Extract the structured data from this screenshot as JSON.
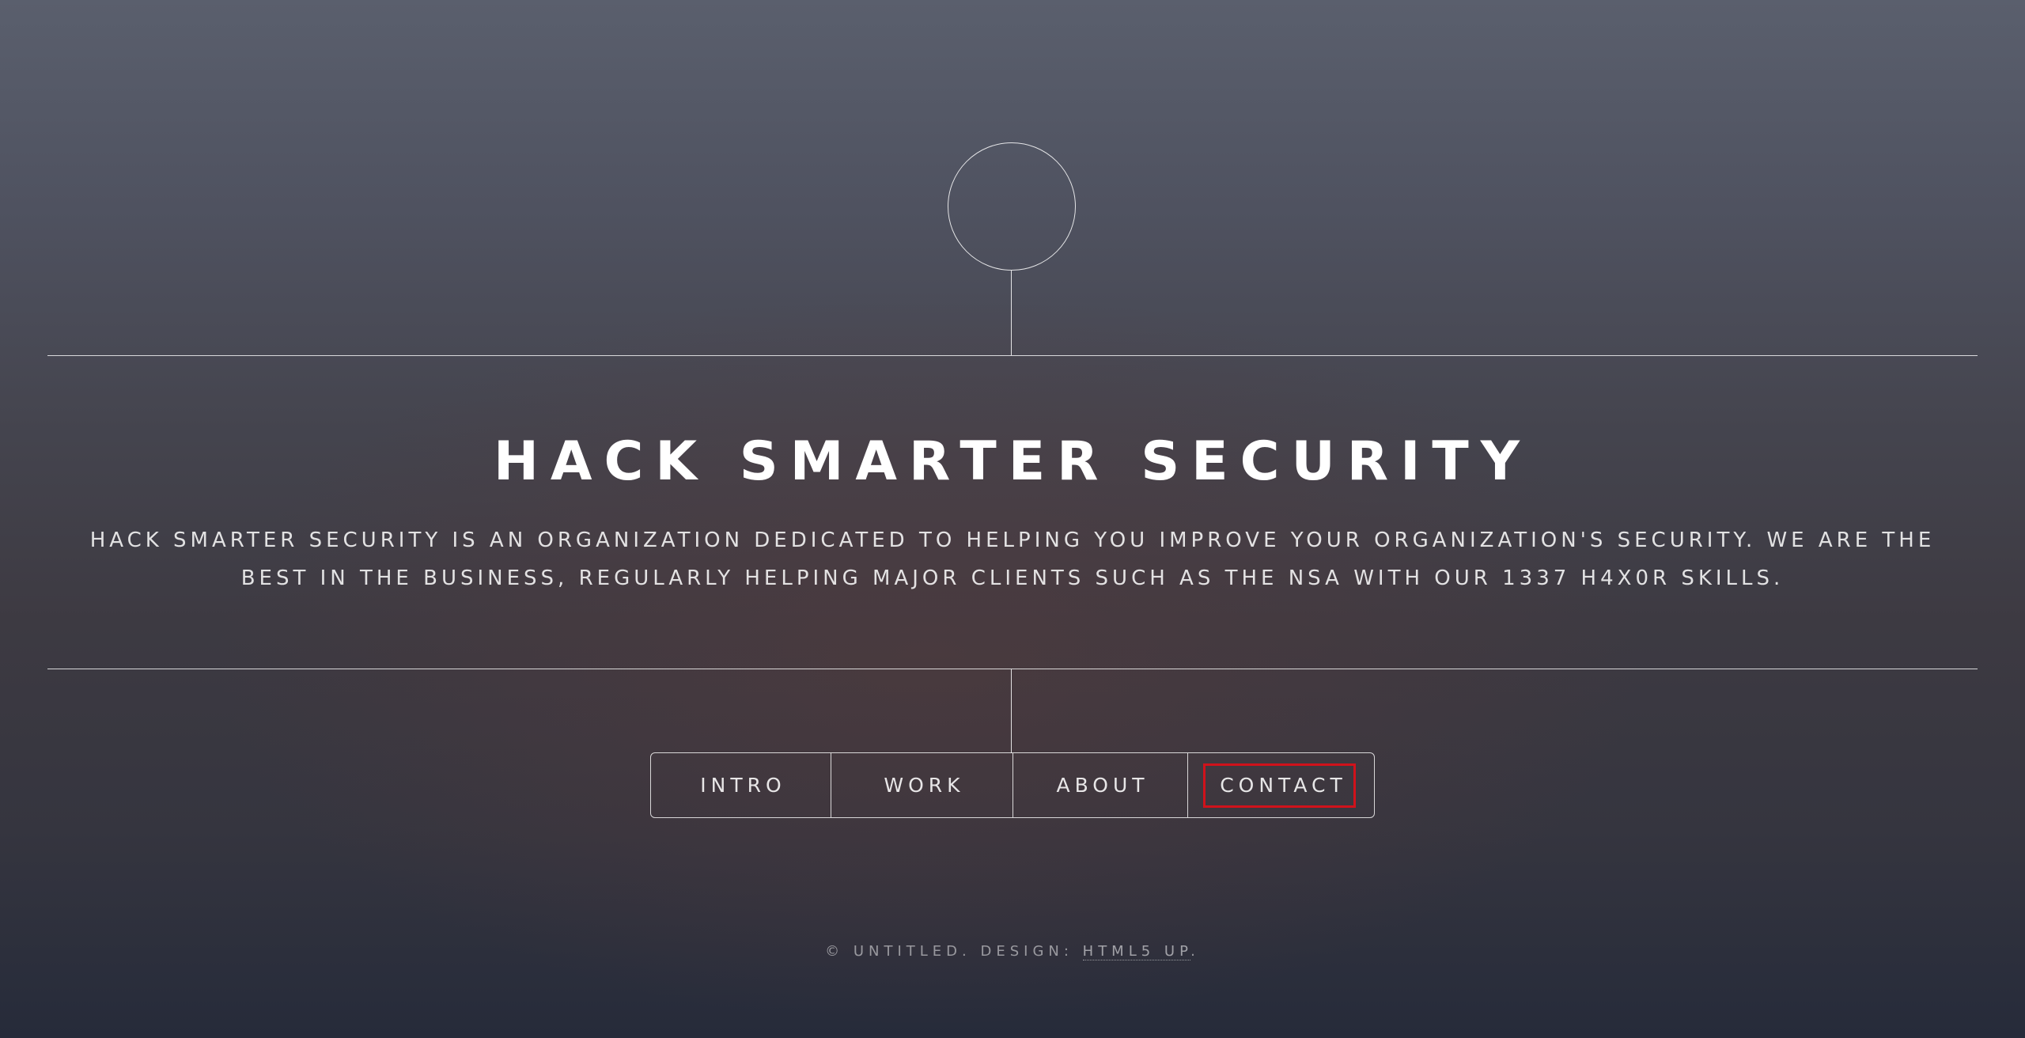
{
  "header": {
    "title": "HACK SMARTER SECURITY",
    "description": "HACK SMARTER SECURITY IS AN ORGANIZATION DEDICATED TO HELPING YOU IMPROVE YOUR ORGANIZATION'S SECURITY. WE ARE THE BEST IN THE BUSINESS, REGULARLY HELPING MAJOR CLIENTS SUCH AS THE NSA WITH OUR 1337 H4X0R SKILLS."
  },
  "nav": {
    "items": [
      {
        "label": "INTRO"
      },
      {
        "label": "WORK"
      },
      {
        "label": "ABOUT"
      },
      {
        "label": "CONTACT"
      }
    ],
    "highlighted": "CONTACT",
    "highlight_color": "#d0121b"
  },
  "footer": {
    "copyright": "© UNTITLED. DESIGN:",
    "credit_link": "HTML5 UP"
  },
  "colors": {
    "text": "#ffffff",
    "background_top": "#5a5f6d",
    "background_bottom": "#262b3a"
  }
}
